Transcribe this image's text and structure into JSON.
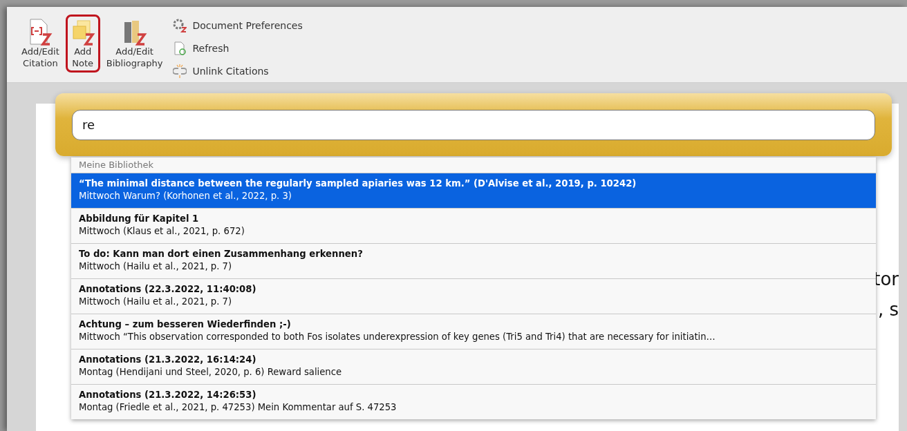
{
  "toolbar": {
    "big_buttons": [
      {
        "kind": "citation",
        "label": "Add/Edit\nCitation",
        "selected": false
      },
      {
        "kind": "note",
        "label": "Add\nNote",
        "selected": true
      },
      {
        "kind": "bibliography",
        "label": "Add/Edit\nBibliography",
        "selected": false
      }
    ],
    "small_buttons": [
      {
        "kind": "preferences",
        "label": "Document Preferences"
      },
      {
        "kind": "refresh",
        "label": "Refresh"
      },
      {
        "kind": "unlink",
        "label": "Unlink Citations"
      }
    ]
  },
  "document": {
    "fragments": [
      "tor",
      ", s"
    ]
  },
  "search": {
    "value": "re"
  },
  "results": {
    "section": "Meine Bibliothek",
    "items": [
      {
        "title": "“The minimal distance between the regularly sampled apiaries was 12 km.” (D'Alvise et al., 2019, p. 10242)",
        "detail": "Mittwoch Warum? (Korhonen et al., 2022, p. 3)",
        "selected": true
      },
      {
        "title": "Abbildung für Kapitel 1",
        "detail": "Mittwoch (Klaus et al., 2021, p. 672)",
        "selected": false
      },
      {
        "title": "To do: Kann man dort einen Zusammenhang erkennen?",
        "detail": "Mittwoch (Hailu et al., 2021, p. 7)",
        "selected": false
      },
      {
        "title": "Annotations (22.3.2022, 11:40:08)",
        "detail": "Mittwoch (Hailu et al., 2021, p. 7)",
        "selected": false
      },
      {
        "title": "Achtung – zum besseren Wiederfinden ;-)",
        "detail": "Mittwoch “This observation corresponded to both Fos isolates underexpression of key genes (Tri5 and Tri4) that are necessary for initiatin…",
        "selected": false
      },
      {
        "title": "Annotations (21.3.2022, 16:14:24)",
        "detail": "Montag (Hendijani und Steel, 2020, p. 6) Reward salience",
        "selected": false
      },
      {
        "title": "Annotations (21.3.2022, 14:26:53)",
        "detail": "Montag (Friedle et al., 2021, p. 47253) Mein Kommentar auf S. 47253",
        "selected": false
      }
    ]
  }
}
